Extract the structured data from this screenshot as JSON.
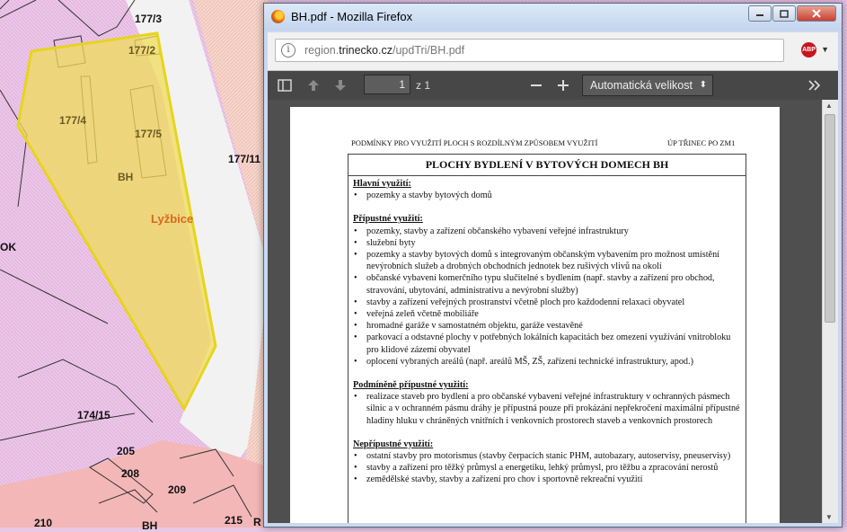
{
  "map": {
    "parcels": [
      "177/3",
      "177/2",
      "177/4",
      "177/5",
      "BH",
      "177/11",
      "174/15",
      "205",
      "208",
      "209",
      "210",
      "215",
      "BH",
      "OK",
      "R"
    ],
    "place_name": "Lyžbice"
  },
  "window": {
    "title": "BH.pdf - Mozilla Firefox",
    "url_prefix": "region.",
    "url_domain": "trinecko.cz",
    "url_path": "/updTri/BH.pdf",
    "abp_label": "ABP"
  },
  "pdf_toolbar": {
    "page_number": "1",
    "page_count": "z 1",
    "zoom": "Automatická velikost"
  },
  "document": {
    "header_left": "PODMÍNKY PRO VYUŽITÍ PLOCH S ROZDÍLNÝM ZPŮSOBEM VYUŽITÍ",
    "header_right": "ÚP TŘINEC PO ZM1",
    "title": "PLOCHY BYDLENÍ V BYTOVÝCH DOMECH  BH",
    "sections": [
      {
        "heading": "Hlavní využití:",
        "items": [
          "pozemky a stavby bytových domů"
        ]
      },
      {
        "heading": "Přípustné využití:",
        "items": [
          "pozemky, stavby a zařízení občanského vybavení veřejné infrastruktury",
          "služební byty",
          "pozemky a stavby bytových domů s integrovaným občanským vybavením pro možnost umístění nevýrobních služeb a drobných obchodních jednotek bez rušivých vlivů na okolí",
          "občanské vybavení komerčního typu slučitelné s bydlením (např. stavby a zařízení pro obchod, stravování, ubytování, administrativu a nevýrobní služby)",
          "stavby a zařízení veřejných prostranství včetně ploch pro každodenní relaxaci obyvatel",
          "veřejná zeleň včetně mobiliáře",
          "hromadné garáže v samostatném objektu, garáže vestavěné",
          "parkovací a odstavné plochy v potřebných lokálních kapacitách bez omezení využívání vnitrobloku pro klidové zázemí obyvatel",
          "oplocení vybraných areálů (např. areálů MŠ, ZŠ, zařízení technické infrastruktury, apod.)"
        ]
      },
      {
        "heading": "Podmíněně přípustné využití:",
        "items": [
          "realizace staveb pro bydlení a pro občanské vybavení veřejné infrastruktury v ochranných pásmech silnic a v ochranném  pásmu dráhy  je přípustná pouze při prokázání nepřekročení maximální přípustné hladiny hluku v chráněných vnitřních i venkovních prostorech staveb a venkovních prostorech"
        ]
      },
      {
        "heading": "Nepřípustné využití:",
        "items": [
          "ostatní stavby pro motorismus (stavby čerpacích stanic PHM, autobazary, autoservisy, pneuservisy)",
          "stavby a zařízení pro těžký průmysl a energetiku, lehký průmysl, pro těžbu a zpracování nerostů",
          "zemědělské stavby, stavby a zařízení pro chov i sportovně rekreační využití"
        ]
      }
    ]
  }
}
